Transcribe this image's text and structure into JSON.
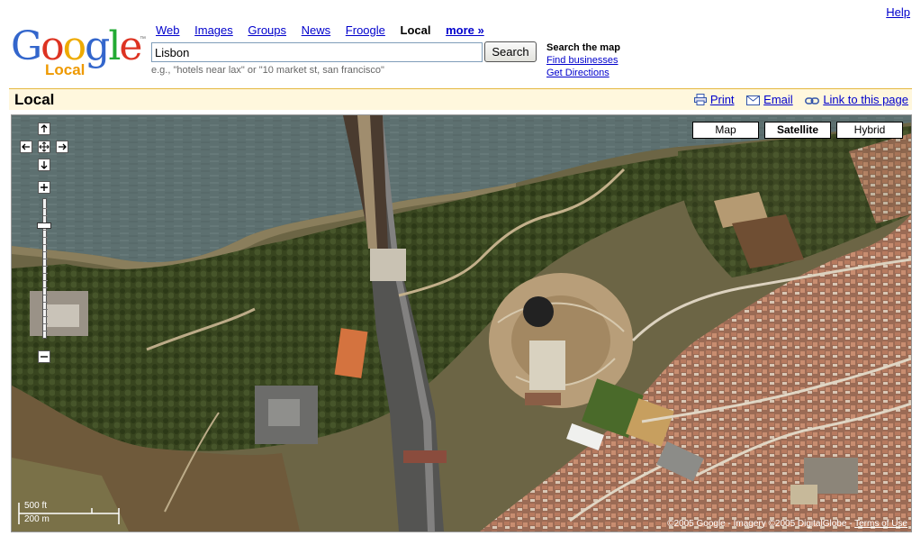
{
  "header": {
    "help": "Help",
    "logo_word": "Google",
    "logo_sub": "Local",
    "logo_tm": "™",
    "tabs": [
      {
        "label": "Web"
      },
      {
        "label": "Images"
      },
      {
        "label": "Groups"
      },
      {
        "label": "News"
      },
      {
        "label": "Froogle"
      },
      {
        "label": "Local"
      },
      {
        "label": "more »"
      }
    ],
    "current_tab": "Local"
  },
  "search": {
    "value": "Lisbon",
    "button": "Search",
    "example": "e.g., \"hotels near lax\" or \"10 market st, san francisco\""
  },
  "search_map": {
    "title": "Search the map",
    "find_businesses": "Find businesses",
    "get_directions": "Get Directions"
  },
  "local_bar": {
    "title": "Local",
    "print": "Print",
    "email": "Email",
    "link": "Link to this page"
  },
  "map": {
    "types": [
      "Map",
      "Satellite",
      "Hybrid"
    ],
    "selected_type": "Satellite",
    "scale_ft": "500 ft",
    "scale_m": "200 m",
    "copyright": "©2005 Google - Imagery ©2005 DigitalGlobe - ",
    "terms": "Terms of Use",
    "icons": [
      "pan-up-icon",
      "pan-left-icon",
      "pan-center-icon",
      "pan-right-icon",
      "pan-down-icon",
      "zoom-in-icon",
      "zoom-out-icon"
    ]
  },
  "colors": {
    "link": "#0000cc",
    "bar_bg": "#fff7dd",
    "bar_border": "#e5b841",
    "logo_local": "#ee9900",
    "water": "#5a6e6e",
    "vegetation": "#3d4a26",
    "urban": "#a9755a"
  }
}
